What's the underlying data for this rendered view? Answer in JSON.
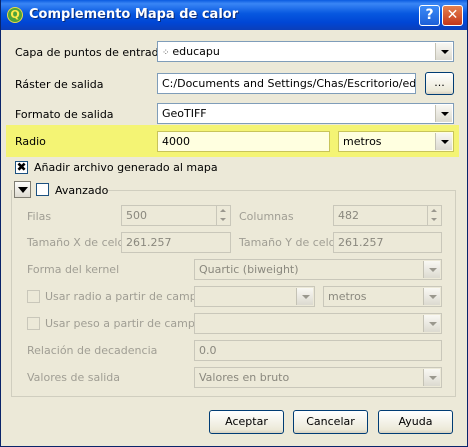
{
  "window": {
    "title": "Complemento Mapa de calor",
    "help": "?",
    "close": "✕"
  },
  "input_layer": {
    "label": "Capa de puntos de entrada",
    "value": "educapu"
  },
  "output_raster": {
    "label": "Ráster de salida",
    "value": "C:/Documents and Settings/Chas/Escritorio/educa",
    "browse": "..."
  },
  "output_format": {
    "label": "Formato de salida",
    "value": "GeoTIFF"
  },
  "radius": {
    "label": "Radio",
    "value": "4000",
    "unit": "metros"
  },
  "add_to_map": {
    "label": "Añadir archivo generado al mapa",
    "checked": true
  },
  "advanced": {
    "label": "Avanzado",
    "rows": {
      "label": "Filas",
      "value": "500"
    },
    "columns": {
      "label": "Columnas",
      "value": "482"
    },
    "cell_x": {
      "label": "Tamaño X de celda",
      "value": "261.257"
    },
    "cell_y": {
      "label": "Tamaño Y de celda",
      "value": "261.257"
    },
    "kernel": {
      "label": "Forma del kernel",
      "value": "Quartic (biweight)"
    },
    "radius_field": {
      "label": "Usar radio a partir de campo",
      "unit": "metros"
    },
    "weight_field": {
      "label": "Usar peso a partir de campo"
    },
    "decay": {
      "label": "Relación de decadencia",
      "value": "0.0"
    },
    "output_values": {
      "label": "Valores de salida",
      "value": "Valores en bruto"
    }
  },
  "buttons": {
    "accept": "Aceptar",
    "cancel": "Cancelar",
    "help": "Ayuda"
  },
  "colors": {
    "titlebar": "#0054e3",
    "highlight": "#f4f474"
  }
}
